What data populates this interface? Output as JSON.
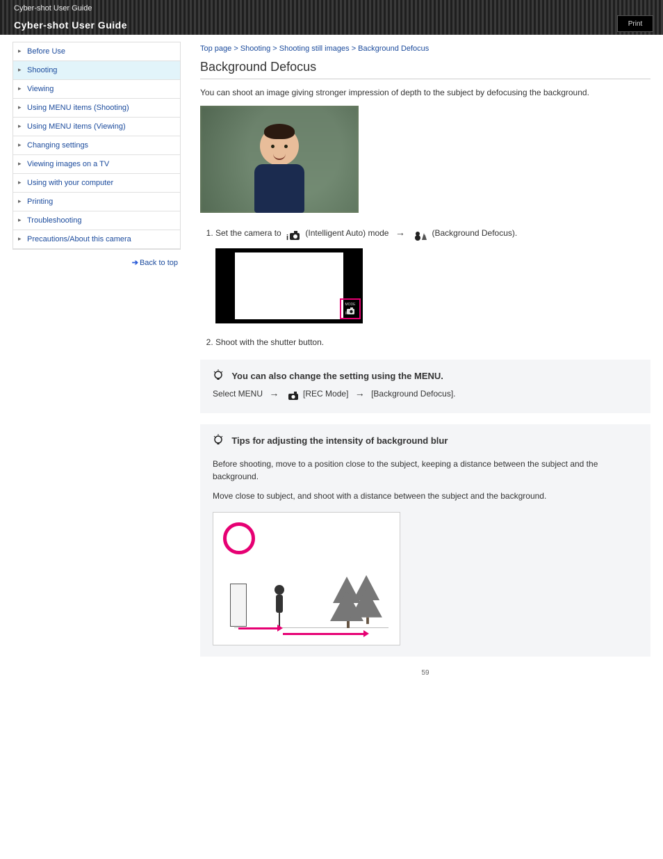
{
  "header": {
    "site": "Cyber-shot User Guide",
    "guide": "Cyber-shot User Guide",
    "print_label": "Print"
  },
  "breadcrumb": "Top page > Shooting > Shooting still images > Background Defocus",
  "sidebar": {
    "items": [
      {
        "label": "Before Use"
      },
      {
        "label": "Shooting"
      },
      {
        "label": "Viewing"
      },
      {
        "label": "Using MENU items (Shooting)"
      },
      {
        "label": "Using MENU items (Viewing)"
      },
      {
        "label": "Changing settings"
      },
      {
        "label": "Viewing images on a TV"
      },
      {
        "label": "Using with your computer"
      },
      {
        "label": "Printing"
      },
      {
        "label": "Troubleshooting"
      },
      {
        "label": "Precautions/About this camera"
      }
    ],
    "back_top": "Back to top"
  },
  "main": {
    "title": "Background Defocus",
    "intro": "You can shoot an image giving stronger impression of depth to the subject by defocusing the background.",
    "steps": {
      "s1_a": "Set the camera to ",
      "s1_b": " (Intelligent Auto) mode ",
      "s1_arrow": "→",
      "s1_c": " (Background Defocus).",
      "s2": "Shoot with the shutter button."
    },
    "note1": {
      "label": "You can also change the setting using the MENU.",
      "body_a": "Select MENU ",
      "body_b": " [REC Mode] ",
      "body_c": " [Background Defocus]."
    },
    "note2": {
      "label": "Tips for adjusting the intensity of background blur",
      "body1": "Before shooting, move to a position close to the subject, keeping a distance between the subject and the background.",
      "body2": "Move close to subject, and shoot with a distance between the subject and the background."
    }
  },
  "page_number": "59"
}
